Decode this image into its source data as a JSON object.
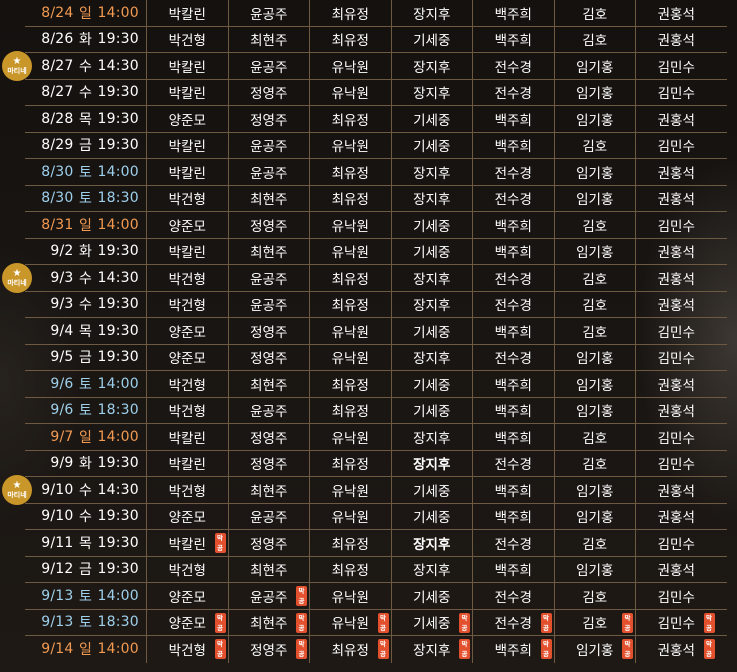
{
  "colors": {
    "weekday": "#ffffff",
    "saturday": "#9ed0ec",
    "sunday": "#f29a52",
    "badge": "#e2502e",
    "matinee": "#c9962a",
    "grid": "#6e5a42"
  },
  "badge_text": "막공",
  "matinee_label": "마티네",
  "rows": [
    {
      "date": "8/24",
      "day": "일",
      "time": "14:00",
      "type": "sun",
      "matinee": false,
      "cast": [
        "박칼린",
        "윤공주",
        "최유정",
        "장지후",
        "백주희",
        "김호",
        "권홍석"
      ]
    },
    {
      "date": "8/26",
      "day": "화",
      "time": "19:30",
      "type": "wd",
      "matinee": false,
      "cast": [
        "박건형",
        "최현주",
        "최유정",
        "기세중",
        "백주희",
        "김호",
        "권홍석"
      ]
    },
    {
      "date": "8/27",
      "day": "수",
      "time": "14:30",
      "type": "wd",
      "matinee": true,
      "cast": [
        "박칼린",
        "윤공주",
        "유낙원",
        "장지후",
        "전수경",
        "임기홍",
        "김민수"
      ]
    },
    {
      "date": "8/27",
      "day": "수",
      "time": "19:30",
      "type": "wd",
      "matinee": false,
      "cast": [
        "박칼린",
        "정영주",
        "유낙원",
        "장지후",
        "전수경",
        "임기홍",
        "김민수"
      ]
    },
    {
      "date": "8/28",
      "day": "목",
      "time": "19:30",
      "type": "wd",
      "matinee": false,
      "cast": [
        "양준모",
        "정영주",
        "최유정",
        "기세중",
        "백주희",
        "임기홍",
        "권홍석"
      ]
    },
    {
      "date": "8/29",
      "day": "금",
      "time": "19:30",
      "type": "wd",
      "matinee": false,
      "cast": [
        "박칼린",
        "윤공주",
        "유낙원",
        "기세중",
        "백주희",
        "김호",
        "김민수"
      ]
    },
    {
      "date": "8/30",
      "day": "토",
      "time": "14:00",
      "type": "sat",
      "matinee": false,
      "cast": [
        "박칼린",
        "윤공주",
        "최유정",
        "장지후",
        "전수경",
        "임기홍",
        "권홍석"
      ]
    },
    {
      "date": "8/30",
      "day": "토",
      "time": "18:30",
      "type": "sat",
      "matinee": false,
      "cast": [
        "박건형",
        "최현주",
        "최유정",
        "장지후",
        "전수경",
        "임기홍",
        "권홍석"
      ]
    },
    {
      "date": "8/31",
      "day": "일",
      "time": "14:00",
      "type": "sun",
      "matinee": false,
      "cast": [
        "양준모",
        "정영주",
        "유낙원",
        "기세중",
        "백주희",
        "김호",
        "김민수"
      ]
    },
    {
      "date": "9/2",
      "day": "화",
      "time": "19:30",
      "type": "wd",
      "matinee": false,
      "cast": [
        "박칼린",
        "최현주",
        "유낙원",
        "기세중",
        "백주희",
        "임기홍",
        "권홍석"
      ]
    },
    {
      "date": "9/3",
      "day": "수",
      "time": "14:30",
      "type": "wd",
      "matinee": true,
      "cast": [
        "박건형",
        "윤공주",
        "최유정",
        "장지후",
        "전수경",
        "김호",
        "권홍석"
      ]
    },
    {
      "date": "9/3",
      "day": "수",
      "time": "19:30",
      "type": "wd",
      "matinee": false,
      "cast": [
        "박건형",
        "윤공주",
        "최유정",
        "장지후",
        "전수경",
        "김호",
        "권홍석"
      ]
    },
    {
      "date": "9/4",
      "day": "목",
      "time": "19:30",
      "type": "wd",
      "matinee": false,
      "cast": [
        "양준모",
        "정영주",
        "유낙원",
        "기세중",
        "백주희",
        "김호",
        "김민수"
      ]
    },
    {
      "date": "9/5",
      "day": "금",
      "time": "19:30",
      "type": "wd",
      "matinee": false,
      "cast": [
        "양준모",
        "정영주",
        "유낙원",
        "장지후",
        "전수경",
        "임기홍",
        "김민수"
      ]
    },
    {
      "date": "9/6",
      "day": "토",
      "time": "14:00",
      "type": "sat",
      "matinee": false,
      "cast": [
        "박건형",
        "최현주",
        "최유정",
        "기세중",
        "백주희",
        "임기홍",
        "권홍석"
      ]
    },
    {
      "date": "9/6",
      "day": "토",
      "time": "18:30",
      "type": "sat",
      "matinee": false,
      "cast": [
        "박건형",
        "윤공주",
        "최유정",
        "기세중",
        "백주희",
        "임기홍",
        "권홍석"
      ]
    },
    {
      "date": "9/7",
      "day": "일",
      "time": "14:00",
      "type": "sun",
      "matinee": false,
      "cast": [
        "박칼린",
        "정영주",
        "유낙원",
        "장지후",
        "백주희",
        "김호",
        "김민수"
      ]
    },
    {
      "date": "9/9",
      "day": "화",
      "time": "19:30",
      "type": "wd",
      "matinee": false,
      "cast": [
        "박칼린",
        "정영주",
        "최유정",
        "장지후",
        "전수경",
        "김호",
        "김민수"
      ],
      "bold": [
        3
      ]
    },
    {
      "date": "9/10",
      "day": "수",
      "time": "14:30",
      "type": "wd",
      "matinee": true,
      "cast": [
        "박건형",
        "최현주",
        "유낙원",
        "기세중",
        "백주희",
        "임기홍",
        "권홍석"
      ]
    },
    {
      "date": "9/10",
      "day": "수",
      "time": "19:30",
      "type": "wd",
      "matinee": false,
      "cast": [
        "양준모",
        "윤공주",
        "유낙원",
        "기세중",
        "백주희",
        "임기홍",
        "권홍석"
      ]
    },
    {
      "date": "9/11",
      "day": "목",
      "time": "19:30",
      "type": "wd",
      "matinee": false,
      "cast": [
        "박칼린",
        "정영주",
        "최유정",
        "장지후",
        "전수경",
        "김호",
        "김민수"
      ],
      "bold": [
        3
      ],
      "badges": [
        0
      ]
    },
    {
      "date": "9/12",
      "day": "금",
      "time": "19:30",
      "type": "wd",
      "matinee": false,
      "cast": [
        "박건형",
        "최현주",
        "최유정",
        "장지후",
        "백주희",
        "임기홍",
        "권홍석"
      ]
    },
    {
      "date": "9/13",
      "day": "토",
      "time": "14:00",
      "type": "sat",
      "matinee": false,
      "cast": [
        "양준모",
        "윤공주",
        "유낙원",
        "기세중",
        "전수경",
        "김호",
        "김민수"
      ],
      "badges": [
        1
      ]
    },
    {
      "date": "9/13",
      "day": "토",
      "time": "18:30",
      "type": "sat",
      "matinee": false,
      "cast": [
        "양준모",
        "최현주",
        "유낙원",
        "기세중",
        "전수경",
        "김호",
        "김민수"
      ],
      "badges": [
        0,
        1,
        2,
        3,
        4,
        5,
        6
      ]
    },
    {
      "date": "9/14",
      "day": "일",
      "time": "14:00",
      "type": "sun",
      "matinee": false,
      "cast": [
        "박건형",
        "정영주",
        "최유정",
        "장지후",
        "백주희",
        "임기홍",
        "권홍석"
      ],
      "badges": [
        0,
        1,
        2,
        3,
        4,
        5,
        6
      ]
    }
  ]
}
